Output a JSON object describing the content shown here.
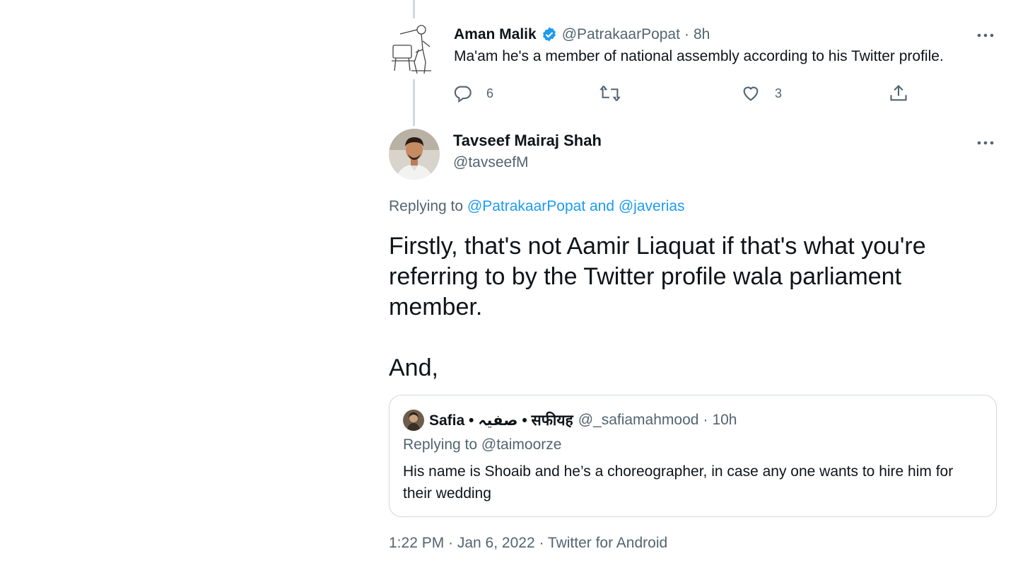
{
  "parent_tweet": {
    "name": "Aman Malik",
    "handle": "@PatrakaarPopat",
    "time": "8h",
    "text": "Ma'am he's a member of national assembly according to his Twitter profile.",
    "reply_count": "6",
    "like_count": "3",
    "icons": {
      "verified": "verified-badge-icon",
      "reply": "reply-icon",
      "retweet": "retweet-icon",
      "like": "heart-icon",
      "share": "share-icon",
      "more": "more-icon"
    }
  },
  "main_tweet": {
    "name": "Tavseef Mairaj Shah",
    "handle": "@tavseefM",
    "replying_prefix": "Replying to",
    "replying_to": "@PatrakaarPopat and @javerias",
    "text_line1": "Firstly, that's not Aamir Liaquat if that's what you're referring to by the Twitter profile wala parliament member.",
    "text_line2": "And,",
    "timestamp": "1:22 PM · Jan 6, 2022 · ",
    "source": "Twitter for Android"
  },
  "quoted_tweet": {
    "name": "Safia • صفیہ • सफीयह",
    "handle": "@_safiamahmood",
    "time": "10h",
    "replying_prefix": "Replying to",
    "replying_to": "@taimoorze",
    "text": "His name is Shoaib and he’s a choreographer, in case any one wants to hire him for their wedding"
  },
  "colors": {
    "text": "#0f1419",
    "muted": "#536471",
    "link": "#1d9bf0",
    "border": "#cfd9de",
    "verified": "#1d9bf0"
  }
}
